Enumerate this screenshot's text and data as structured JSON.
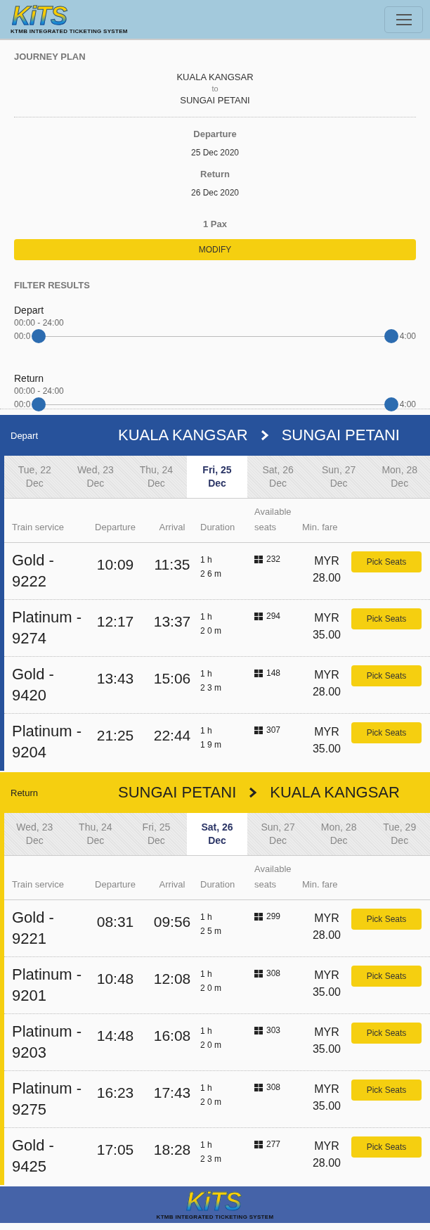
{
  "header": {
    "logo": "KiTS",
    "tagline": "KTMB INTEGRATED TICKETING SYSTEM"
  },
  "journey_plan": {
    "title": "JOURNEY PLAN",
    "from": "KUALA KANGSAR",
    "to_word": "to",
    "to": "SUNGAI PETANI",
    "departure_label": "Departure",
    "departure_date": "25 Dec 2020",
    "return_label": "Return",
    "return_date": "26 Dec 2020",
    "pax": "1 Pax",
    "modify_button": "MODIFY"
  },
  "filter": {
    "title": "FILTER RESULTS",
    "sliders": [
      {
        "label": "Depart",
        "range": "00:00 - 24:00",
        "min_label": "00:0",
        "max_label": "4:00",
        "thumbs": [
          {
            "level": 0
          },
          {
            "level": 1
          }
        ]
      },
      {
        "label": "Return",
        "range": "00:00 - 24:00",
        "min_label": "00:0",
        "max_label": "4:00",
        "thumbs": [
          {
            "level": 0
          },
          {
            "level": 1
          }
        ]
      }
    ]
  },
  "sections": [
    {
      "kind": "depart",
      "label": "Depart",
      "from": "KUALA KANGSAR",
      "to": "SUNGAI PETANI",
      "dates": [
        {
          "day": "Tue, 22",
          "month": "Dec",
          "selected": false
        },
        {
          "day": "Wed, 23",
          "month": "Dec",
          "selected": false
        },
        {
          "day": "Thu, 24",
          "month": "Dec",
          "selected": false
        },
        {
          "day": "Fri, 25",
          "month": "Dec",
          "selected": true
        },
        {
          "day": "Sat, 26",
          "month": "Dec",
          "selected": false
        },
        {
          "day": "Sun, 27",
          "month": "Dec",
          "selected": false
        },
        {
          "day": "Mon, 28",
          "month": "Dec",
          "selected": false
        }
      ],
      "columns": [
        "Train service",
        "Departure",
        "Arrival",
        "Duration",
        "Available seats",
        "Min. fare"
      ],
      "trains": [
        {
          "service": "Gold - 9222",
          "departure": "10:09",
          "arrival": "11:35",
          "hours": "1 h",
          "minutes": "2 6 m",
          "seats": "232",
          "currency": "MYR",
          "fare": "28.00",
          "button": "Pick Seats"
        },
        {
          "service": "Platinum - 9274",
          "departure": "12:17",
          "arrival": "13:37",
          "hours": "1 h",
          "minutes": "2 0 m",
          "seats": "294",
          "currency": "MYR",
          "fare": "35.00",
          "button": "Pick Seats"
        },
        {
          "service": "Gold - 9420",
          "departure": "13:43",
          "arrival": "15:06",
          "hours": "1 h",
          "minutes": "2 3 m",
          "seats": "148",
          "currency": "MYR",
          "fare": "28.00",
          "button": "Pick Seats"
        },
        {
          "service": "Platinum - 9204",
          "departure": "21:25",
          "arrival": "22:44",
          "hours": "1 h",
          "minutes": "1 9 m",
          "seats": "307",
          "currency": "MYR",
          "fare": "35.00",
          "button": "Pick Seats"
        }
      ]
    },
    {
      "kind": "return",
      "label": "Return",
      "from": "SUNGAI PETANI",
      "to": "KUALA KANGSAR",
      "dates": [
        {
          "day": "Wed, 23",
          "month": "Dec",
          "selected": false
        },
        {
          "day": "Thu, 24",
          "month": "Dec",
          "selected": false
        },
        {
          "day": "Fri, 25",
          "month": "Dec",
          "selected": false
        },
        {
          "day": "Sat, 26",
          "month": "Dec",
          "selected": true
        },
        {
          "day": "Sun, 27",
          "month": "Dec",
          "selected": false
        },
        {
          "day": "Mon, 28",
          "month": "Dec",
          "selected": false
        },
        {
          "day": "Tue, 29",
          "month": "Dec",
          "selected": false
        }
      ],
      "columns": [
        "Train service",
        "Departure",
        "Arrival",
        "Duration",
        "Available seats",
        "Min. fare"
      ],
      "trains": [
        {
          "service": "Gold - 9221",
          "departure": "08:31",
          "arrival": "09:56",
          "hours": "1 h",
          "minutes": "2 5 m",
          "seats": "299",
          "currency": "MYR",
          "fare": "28.00",
          "button": "Pick Seats"
        },
        {
          "service": "Platinum - 9201",
          "departure": "10:48",
          "arrival": "12:08",
          "hours": "1 h",
          "minutes": "2 0 m",
          "seats": "308",
          "currency": "MYR",
          "fare": "35.00",
          "button": "Pick Seats"
        },
        {
          "service": "Platinum - 9203",
          "departure": "14:48",
          "arrival": "16:08",
          "hours": "1 h",
          "minutes": "2 0 m",
          "seats": "303",
          "currency": "MYR",
          "fare": "35.00",
          "button": "Pick Seats"
        },
        {
          "service": "Platinum - 9275",
          "departure": "16:23",
          "arrival": "17:43",
          "hours": "1 h",
          "minutes": "2 0 m",
          "seats": "308",
          "currency": "MYR",
          "fare": "35.00",
          "button": "Pick Seats"
        },
        {
          "service": "Gold - 9425",
          "departure": "17:05",
          "arrival": "18:28",
          "hours": "1 h",
          "minutes": "2 3 m",
          "seats": "277",
          "currency": "MYR",
          "fare": "28.00",
          "button": "Pick Seats"
        }
      ]
    }
  ],
  "footer": {
    "logo": "KiTS",
    "tagline": "KTMB INTEGRATED TICKETING SYSTEM"
  }
}
